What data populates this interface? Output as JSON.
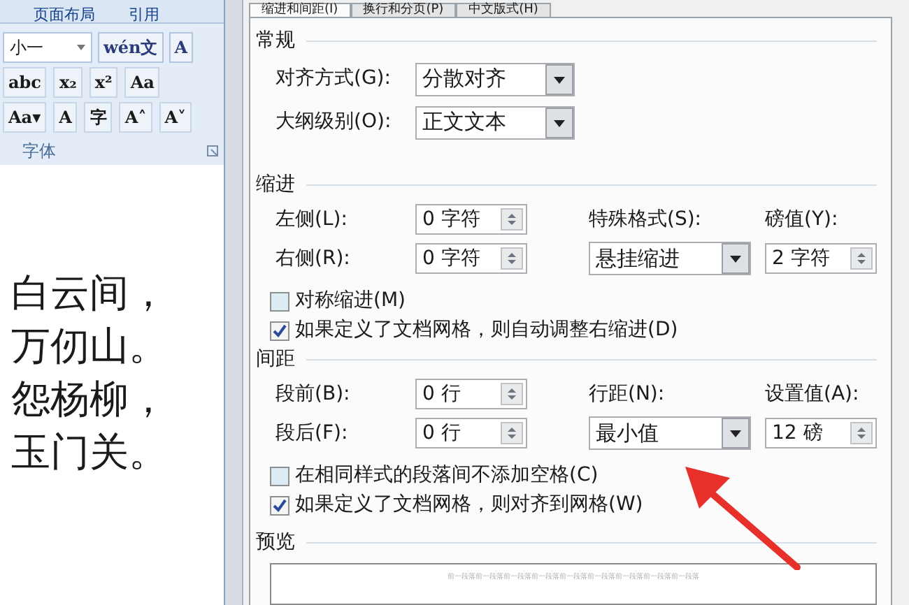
{
  "ribbon": {
    "tabs": [
      {
        "label": "页面布局",
        "selected": false
      },
      {
        "label": "引用",
        "selected": false
      }
    ],
    "font_size": "小一",
    "button_rows": [
      [
        "wén文",
        "A"
      ],
      [
        "abc",
        "x₂",
        "x²",
        "Aa"
      ],
      [
        "Aa▾",
        "A",
        "字",
        "A˄",
        "A˅"
      ]
    ],
    "group_label": "字体"
  },
  "document": {
    "lines": [
      "白云间，",
      "万仞山。",
      "怨杨柳，",
      "玉门关。"
    ]
  },
  "dialog": {
    "tabs": [
      {
        "label": "缩进和间距(I)",
        "selected": true
      },
      {
        "label": "换行和分页(P)",
        "selected": false
      },
      {
        "label": "中文版式(H)",
        "selected": false
      }
    ],
    "general": {
      "title": "常规",
      "fields": [
        {
          "label": "对齐方式(G):",
          "value": "分散对齐"
        },
        {
          "label": "大纲级别(O):",
          "value": "正文文本"
        }
      ]
    },
    "indent": {
      "title": "缩进",
      "rows": [
        {
          "label": "左侧(L):",
          "value": "0 字符",
          "label2": "特殊格式(S):",
          "label3": "磅值(Y):"
        },
        {
          "label": "右侧(R):",
          "value": "0 字符",
          "dropdown": "悬挂缩进",
          "spin": "2 字符"
        }
      ],
      "checks": [
        {
          "label": "对称缩进(M)",
          "checked": false
        },
        {
          "label": "如果定义了文档网格，则自动调整右缩进(D)",
          "checked": true
        }
      ]
    },
    "spacing": {
      "title": "间距",
      "rows": [
        {
          "label": "段前(B):",
          "value": "0 行",
          "label2": "行距(N):",
          "label3": "设置值(A):"
        },
        {
          "label": "段后(F):",
          "value": "0 行",
          "dropdown": "最小值",
          "spin": "12 磅"
        }
      ],
      "checks": [
        {
          "label": "在相同样式的段落间不添加空格(C)",
          "checked": false
        },
        {
          "label": "如果定义了文档网格，则对齐到网格(W)",
          "checked": true
        }
      ]
    },
    "preview": {
      "title": "预览",
      "sample": "前一段落前一段落前一段落前一段落前一段落前一段落前一段落前一段落前一段落"
    }
  }
}
